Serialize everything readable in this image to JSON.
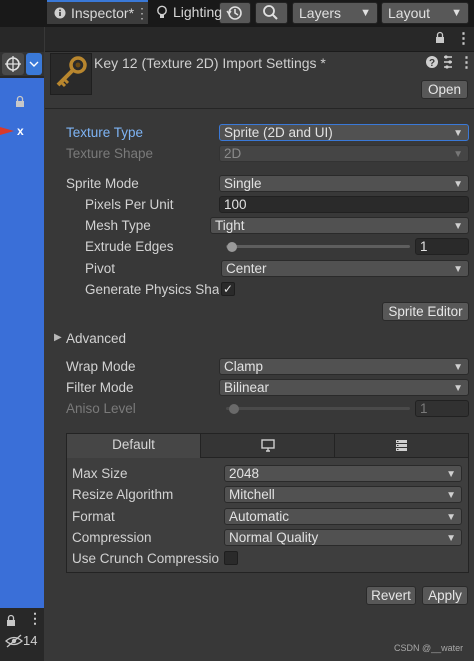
{
  "toolbar": {
    "history_icon": "history-icon",
    "search_icon": "search-icon",
    "layers_label": "Layers",
    "layout_label": "Layout"
  },
  "tabs": {
    "inspector": "Inspector*",
    "lighting": "Lighting"
  },
  "header": {
    "title": "Key 12 (Texture 2D) Import Settings *",
    "open_button": "Open"
  },
  "fields": {
    "texture_type_label": "Texture Type",
    "texture_type_value": "Sprite (2D and UI)",
    "texture_shape_label": "Texture Shape",
    "texture_shape_value": "2D",
    "sprite_mode_label": "Sprite Mode",
    "sprite_mode_value": "Single",
    "pixels_per_unit_label": "Pixels Per Unit",
    "pixels_per_unit_value": "100",
    "mesh_type_label": "Mesh Type",
    "mesh_type_value": "Tight",
    "extrude_edges_label": "Extrude Edges",
    "extrude_edges_value": "1",
    "pivot_label": "Pivot",
    "pivot_value": "Center",
    "generate_physics_label": "Generate Physics Sha",
    "generate_physics_checked": true,
    "sprite_editor_button": "Sprite Editor",
    "advanced_label": "Advanced",
    "wrap_mode_label": "Wrap Mode",
    "wrap_mode_value": "Clamp",
    "filter_mode_label": "Filter Mode",
    "filter_mode_value": "Bilinear",
    "aniso_level_label": "Aniso Level",
    "aniso_level_value": "1"
  },
  "platform": {
    "default_tab": "Default",
    "standalone_icon": "monitor-icon",
    "server_icon": "server-icon",
    "max_size_label": "Max Size",
    "max_size_value": "2048",
    "resize_algorithm_label": "Resize Algorithm",
    "resize_algorithm_value": "Mitchell",
    "format_label": "Format",
    "format_value": "Automatic",
    "compression_label": "Compression",
    "compression_value": "Normal Quality",
    "crunch_label": "Use Crunch Compressio",
    "crunch_checked": false
  },
  "actions": {
    "revert": "Revert",
    "apply": "Apply"
  },
  "left": {
    "visibility_count": "14",
    "x_label": "x"
  },
  "watermark": "CSDN @__water"
}
